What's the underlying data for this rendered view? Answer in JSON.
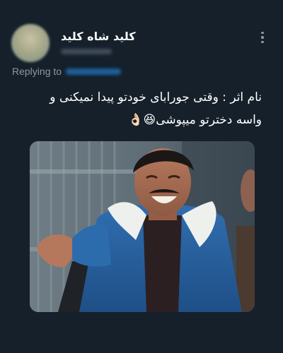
{
  "tweet": {
    "display_name": "کلید شاه کلید",
    "replying_to_label": "Replying to",
    "text_lines": [
      "نام اثر : وقتی جورابای خودتو پیدا نمیکنی و",
      "واسه دخترتو میپوشی😆👌🏻"
    ],
    "more_icon": "more-vertical-icon"
  },
  "colors": {
    "background": "#15202b",
    "secondary_text": "#8b98a5",
    "link": "#1d9bf0"
  }
}
